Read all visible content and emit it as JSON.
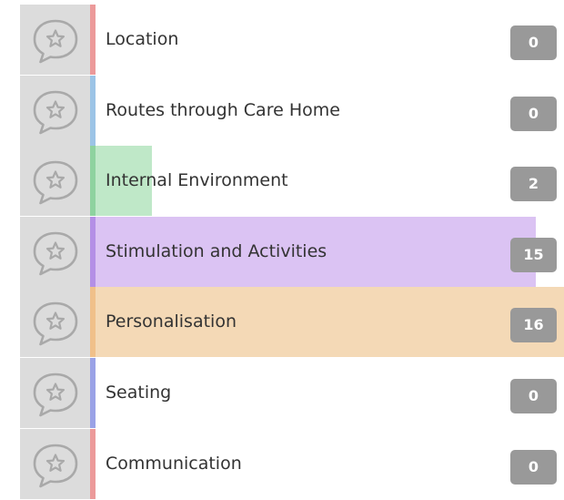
{
  "categories": [
    {
      "label": "Location",
      "count": "0",
      "accent": "#ec9a9a",
      "fill_color": "#f6cccc",
      "share": 0
    },
    {
      "label": "Routes through Care Home",
      "count": "0",
      "accent": "#9cc4e6",
      "fill_color": "#cde2f3",
      "share": 0
    },
    {
      "label": "Internal Environment",
      "count": "2",
      "accent": "#8ed29f",
      "fill_color": "#bfe8c8",
      "share": 0.13
    },
    {
      "label": "Stimulation and Activities",
      "count": "15",
      "accent": "#b48fe6",
      "fill_color": "#dbc3f3",
      "share": 0.94
    },
    {
      "label": "Personalisation",
      "count": "16",
      "accent": "#f0c08a",
      "fill_color": "#f4d9b6",
      "share": 1.0
    },
    {
      "label": "Seating",
      "count": "0",
      "accent": "#9aa2e6",
      "fill_color": "#cdd1f3",
      "share": 0
    },
    {
      "label": "Communication",
      "count": "0",
      "accent": "#ec9a9a",
      "fill_color": "#f6cccc",
      "share": 0
    }
  ],
  "icon": "speech-bubble-star-icon",
  "badge_color": "#999999"
}
